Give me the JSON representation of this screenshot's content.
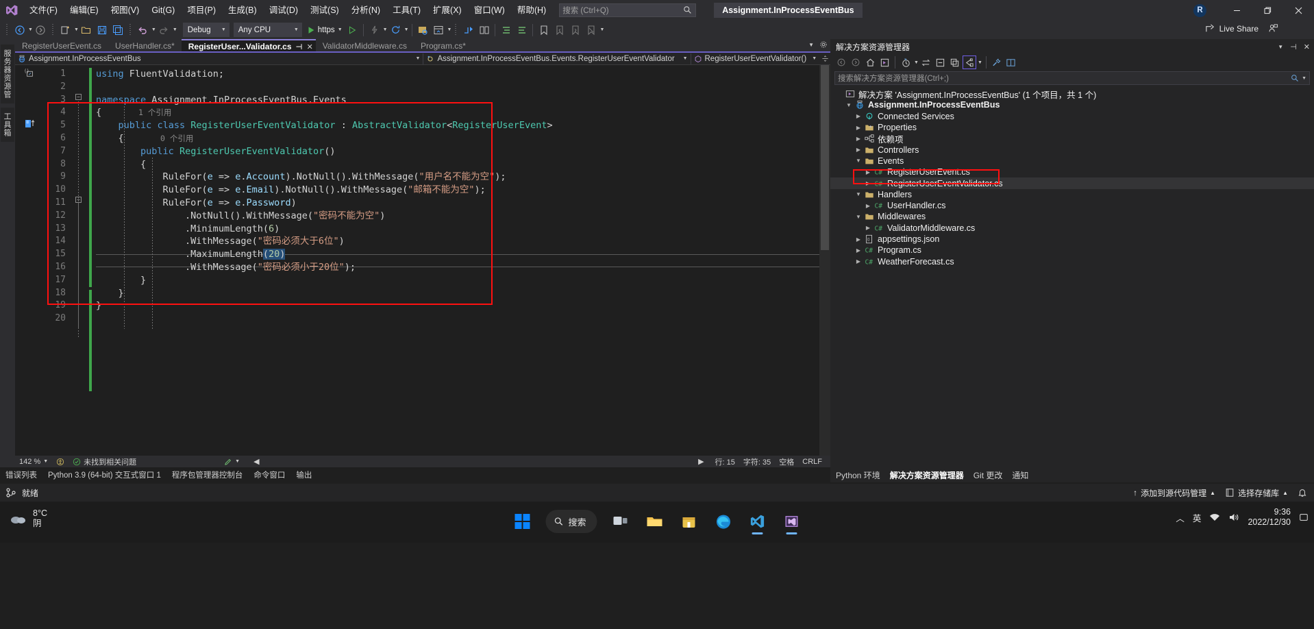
{
  "titlebar": {
    "logo_icon": "visual-studio-logo",
    "menus": [
      {
        "label": "文件(F)"
      },
      {
        "label": "编辑(E)"
      },
      {
        "label": "视图(V)"
      },
      {
        "label": "Git(G)"
      },
      {
        "label": "项目(P)"
      },
      {
        "label": "生成(B)"
      },
      {
        "label": "调试(D)"
      },
      {
        "label": "测试(S)"
      },
      {
        "label": "分析(N)"
      },
      {
        "label": "工具(T)"
      },
      {
        "label": "扩展(X)"
      },
      {
        "label": "窗口(W)"
      },
      {
        "label": "帮助(H)"
      }
    ],
    "search_placeholder": "搜索 (Ctrl+Q)",
    "search_icon": "search-icon",
    "solution_name": "Assignment.InProcessEventBus",
    "account_initial": "R",
    "minimize_icon": "minimize-icon",
    "restore_icon": "restore-icon",
    "close_icon": "close-icon"
  },
  "toolbar": {
    "nav_back_icon": "navigate-back-icon",
    "nav_forward_icon": "navigate-forward-icon",
    "new_project_icon": "new-project-icon",
    "open_file_icon": "open-file-icon",
    "save_icon": "save-icon",
    "save_all_icon": "save-all-icon",
    "undo_icon": "undo-icon",
    "redo_icon": "redo-icon",
    "config_value": "Debug",
    "platform_value": "Any CPU",
    "run_label": "https",
    "run_icon": "play-icon",
    "run_no_debug_icon": "play-outline-icon",
    "hot_reload_icon": "hot-reload-icon",
    "restart_icon": "restart-icon",
    "live_share_label": "Live Share",
    "live_share_icon": "live-share-icon",
    "live_share_people_icon": "live-share-people-icon"
  },
  "left_dock": {
    "tabs": [
      {
        "label": "服务器资源管理器"
      },
      {
        "label": "工具箱"
      }
    ]
  },
  "editor": {
    "tabs": [
      {
        "label": "RegisterUserEvent.cs",
        "active": false,
        "dirty": false
      },
      {
        "label": "UserHandler.cs*",
        "active": false,
        "dirty": true
      },
      {
        "label": "RegisterUser...Validator.cs",
        "active": true,
        "dirty": false
      },
      {
        "label": "ValidatorMiddleware.cs",
        "active": false,
        "dirty": false
      },
      {
        "label": "Program.cs*",
        "active": false,
        "dirty": true
      }
    ],
    "active_tab_pin_icon": "pin-icon",
    "active_tab_close_icon": "close-icon",
    "tabstrip_dropdown_icon": "chevron-down-icon",
    "tabstrip_settings_icon": "gear-icon",
    "breadcrumb": {
      "project_icon": "project-web-icon",
      "project": "Assignment.InProcessEventBus",
      "class_icon": "class-icon",
      "class": "Assignment.InProcessEventBus.Events.RegisterUserEventValidator",
      "member_icon": "method-icon",
      "member": "RegisterUserEventValidator()",
      "split_icon": "split-view-icon"
    },
    "line_numbers": [
      1,
      2,
      3,
      4,
      5,
      6,
      7,
      8,
      9,
      10,
      11,
      12,
      13,
      14,
      15,
      16,
      17,
      18,
      19,
      20
    ],
    "code_lines": [
      {
        "n": 1,
        "html": "<span class=\"kw\">using</span> <span class=\"pl\">FluentValidation;</span>"
      },
      {
        "n": 2,
        "html": ""
      },
      {
        "n": 3,
        "html": "<span class=\"kw\">namespace</span> <span class=\"pl\">Assignment.InProcessEventBus.Events</span>"
      },
      {
        "n": 4,
        "html": "<span class=\"pl\">{</span>"
      },
      {
        "n": 5,
        "html": "    <span class=\"kw\">public</span> <span class=\"kw\">class</span> <span class=\"typ\">RegisterUserEventValidator</span> <span class=\"pl\">:</span> <span class=\"typ\">AbstractValidator</span><span class=\"pl\">&lt;</span><span class=\"typ\">RegisterUserEvent</span><span class=\"pl\">&gt;</span>"
      },
      {
        "n": 6,
        "html": "    <span class=\"pl\">{</span>"
      },
      {
        "n": 7,
        "html": "        <span class=\"kw\">public</span> <span class=\"typ\">RegisterUserEventValidator</span><span class=\"pl\">()</span>"
      },
      {
        "n": 8,
        "html": "        <span class=\"pl\">{</span>"
      },
      {
        "n": 9,
        "html": "            <span class=\"pl\">RuleFor(</span><span class=\"id\">e</span> <span class=\"pl\">=&gt;</span> <span class=\"id\">e</span><span class=\"pl\">.</span><span class=\"id\">Account</span><span class=\"pl\">).NotNull().WithMessage(</span><span class=\"str\">\"用户名不能为空\"</span><span class=\"pl\">);</span>"
      },
      {
        "n": 10,
        "html": "            <span class=\"pl\">RuleFor(</span><span class=\"id\">e</span> <span class=\"pl\">=&gt;</span> <span class=\"id\">e</span><span class=\"pl\">.</span><span class=\"id\">Email</span><span class=\"pl\">).NotNull().WithMessage(</span><span class=\"str\">\"邮箱不能为空\"</span><span class=\"pl\">);</span>"
      },
      {
        "n": 11,
        "html": "            <span class=\"pl\">RuleFor(</span><span class=\"id\">e</span> <span class=\"pl\">=&gt;</span> <span class=\"id\">e</span><span class=\"pl\">.</span><span class=\"id\">Password</span><span class=\"pl\">)</span>"
      },
      {
        "n": 12,
        "html": "                <span class=\"pl\">.NotNull().WithMessage(</span><span class=\"str\">\"密码不能为空\"</span><span class=\"pl\">)</span>"
      },
      {
        "n": 13,
        "html": "                <span class=\"pl\">.MinimumLength(</span><span class=\"num\">6</span><span class=\"pl\">)</span>"
      },
      {
        "n": 14,
        "html": "                <span class=\"pl\">.WithMessage(</span><span class=\"str\">\"密码必须大于6位\"</span><span class=\"pl\">)</span>"
      },
      {
        "n": 15,
        "html": "                <span class=\"pl\">.MaximumLength</span><span class=\"sel\"><span class=\"pl\">(</span><span class=\"num\">20</span><span class=\"pl\">)</span></span>"
      },
      {
        "n": 16,
        "html": "                <span class=\"pl\">.WithMessage(</span><span class=\"str\">\"密码必须小于20位\"</span><span class=\"pl\">);</span>"
      },
      {
        "n": 17,
        "html": "        <span class=\"pl\">}</span>"
      },
      {
        "n": 18,
        "html": "    <span class=\"pl\">}</span>"
      },
      {
        "n": 19,
        "html": "<span class=\"pl\">}</span>"
      },
      {
        "n": 20,
        "html": ""
      }
    ],
    "codelens": [
      {
        "line": 5,
        "text": "1 个引用"
      },
      {
        "line": 7,
        "text": "0 个引用"
      }
    ],
    "status": {
      "zoom": "142 %",
      "zoom_dropdown_icon": "chevron-down-icon",
      "accessibility_icon": "accessibility-icon",
      "issues_icon": "check-circle-icon",
      "issues_text": "未找到相关问题",
      "pencil_icon": "pencil-icon",
      "prev_icon": "prev-arrow-icon",
      "next_icon": "next-arrow-icon",
      "line_label": "行: 15",
      "col_label": "字符: 35",
      "spaces_label": "空格",
      "eol_label": "CRLF"
    }
  },
  "solution_explorer": {
    "title": "解决方案资源管理器",
    "title_dropdown_icon": "chevron-down-icon",
    "title_close_icon": "close-icon",
    "title_pin_icon": "pin-icon",
    "toolbar_icons": [
      "back-icon",
      "forward-icon",
      "home-icon",
      "pending-changes-icon",
      "history-icon",
      "chevron-down-icon",
      "sync-icon",
      "collapse-all-icon",
      "copy-icon",
      "show-all-files-icon",
      "chevron-down-icon",
      "properties-icon",
      "preview-icon"
    ],
    "search_placeholder": "搜索解决方案资源管理器(Ctrl+;)",
    "search_icon": "search-icon",
    "search_dropdown_icon": "chevron-down-icon",
    "tree": [
      {
        "indent": 0,
        "exp": "",
        "icon": "solution-icon",
        "label": "解决方案 'Assignment.InProcessEventBus' (1 个项目，共 1 个)",
        "bold": false,
        "selected": false
      },
      {
        "indent": 1,
        "exp": "▼",
        "icon": "project-web-icon",
        "label": "Assignment.InProcessEventBus",
        "bold": true,
        "selected": false
      },
      {
        "indent": 2,
        "exp": "▶",
        "icon": "connected-services-icon",
        "label": "Connected Services",
        "bold": false,
        "selected": false
      },
      {
        "indent": 2,
        "exp": "▶",
        "icon": "properties-folder-icon",
        "label": "Properties",
        "bold": false,
        "selected": false
      },
      {
        "indent": 2,
        "exp": "▶",
        "icon": "dependencies-icon",
        "label": "依赖项",
        "bold": false,
        "selected": false
      },
      {
        "indent": 2,
        "exp": "▶",
        "icon": "folder-icon",
        "label": "Controllers",
        "bold": false,
        "selected": false
      },
      {
        "indent": 2,
        "exp": "▼",
        "icon": "folder-icon",
        "label": "Events",
        "bold": false,
        "selected": false
      },
      {
        "indent": 3,
        "exp": "▶",
        "icon": "csharp-file-icon",
        "label": "RegisterUserEvent.cs",
        "bold": false,
        "selected": false
      },
      {
        "indent": 3,
        "exp": "▶",
        "icon": "csharp-file-icon",
        "label": "RegisterUserEventValidator.cs",
        "bold": false,
        "selected": true
      },
      {
        "indent": 2,
        "exp": "▼",
        "icon": "folder-icon",
        "label": "Handlers",
        "bold": false,
        "selected": false
      },
      {
        "indent": 3,
        "exp": "▶",
        "icon": "csharp-file-icon",
        "label": "UserHandler.cs",
        "bold": false,
        "selected": false
      },
      {
        "indent": 2,
        "exp": "▼",
        "icon": "folder-icon",
        "label": "Middlewares",
        "bold": false,
        "selected": false
      },
      {
        "indent": 3,
        "exp": "▶",
        "icon": "csharp-file-icon",
        "label": "ValidatorMiddleware.cs",
        "bold": false,
        "selected": false
      },
      {
        "indent": 2,
        "exp": "▶",
        "icon": "json-file-icon",
        "label": "appsettings.json",
        "bold": false,
        "selected": false
      },
      {
        "indent": 2,
        "exp": "▶",
        "icon": "csharp-file-icon",
        "label": "Program.cs",
        "bold": false,
        "selected": false
      },
      {
        "indent": 2,
        "exp": "▶",
        "icon": "csharp-file-icon",
        "label": "WeatherForecast.cs",
        "bold": false,
        "selected": false
      }
    ],
    "bottom_tabs": [
      {
        "label": "Python 环境",
        "selected": false
      },
      {
        "label": "解决方案资源管理器",
        "selected": true
      },
      {
        "label": "Git 更改",
        "selected": false
      },
      {
        "label": "通知",
        "selected": false
      }
    ]
  },
  "bottom_panel_tabs": [
    {
      "label": "错误列表"
    },
    {
      "label": "Python 3.9 (64-bit) 交互式窗口 1"
    },
    {
      "label": "程序包管理器控制台"
    },
    {
      "label": "命令窗口"
    },
    {
      "label": "输出"
    }
  ],
  "vs_status_bar": {
    "source_control_icon": "source-control-icon",
    "ready_text": "就绪",
    "add_to_source_control": "添加到源代码管理",
    "add_to_source_control_icon": "chevron-up-icon",
    "repo_label": "选择存储库",
    "repo_icon": "repository-icon",
    "repo_dropdown_icon": "chevron-up-icon",
    "notify_icon": "bell-icon"
  },
  "taskbar": {
    "weather_temp": "8°C",
    "weather_desc": "阴",
    "weather_icon": "cloud-icon",
    "start_icon": "windows-start-icon",
    "search_label": "搜索",
    "search_icon": "search-icon",
    "apps": [
      {
        "name": "task-view-icon",
        "active": false
      },
      {
        "name": "file-explorer-icon",
        "active": false
      },
      {
        "name": "store-icon",
        "active": false
      },
      {
        "name": "edge-icon",
        "active": false
      },
      {
        "name": "vscode-icon",
        "active": true
      },
      {
        "name": "visual-studio-icon",
        "active": true
      }
    ],
    "tray": {
      "chevron_icon": "chevron-up-icon",
      "ime_label": "英",
      "network_icon": "network-icon",
      "volume_icon": "volume-icon",
      "time": "9:36",
      "date": "2022/12/30"
    }
  }
}
